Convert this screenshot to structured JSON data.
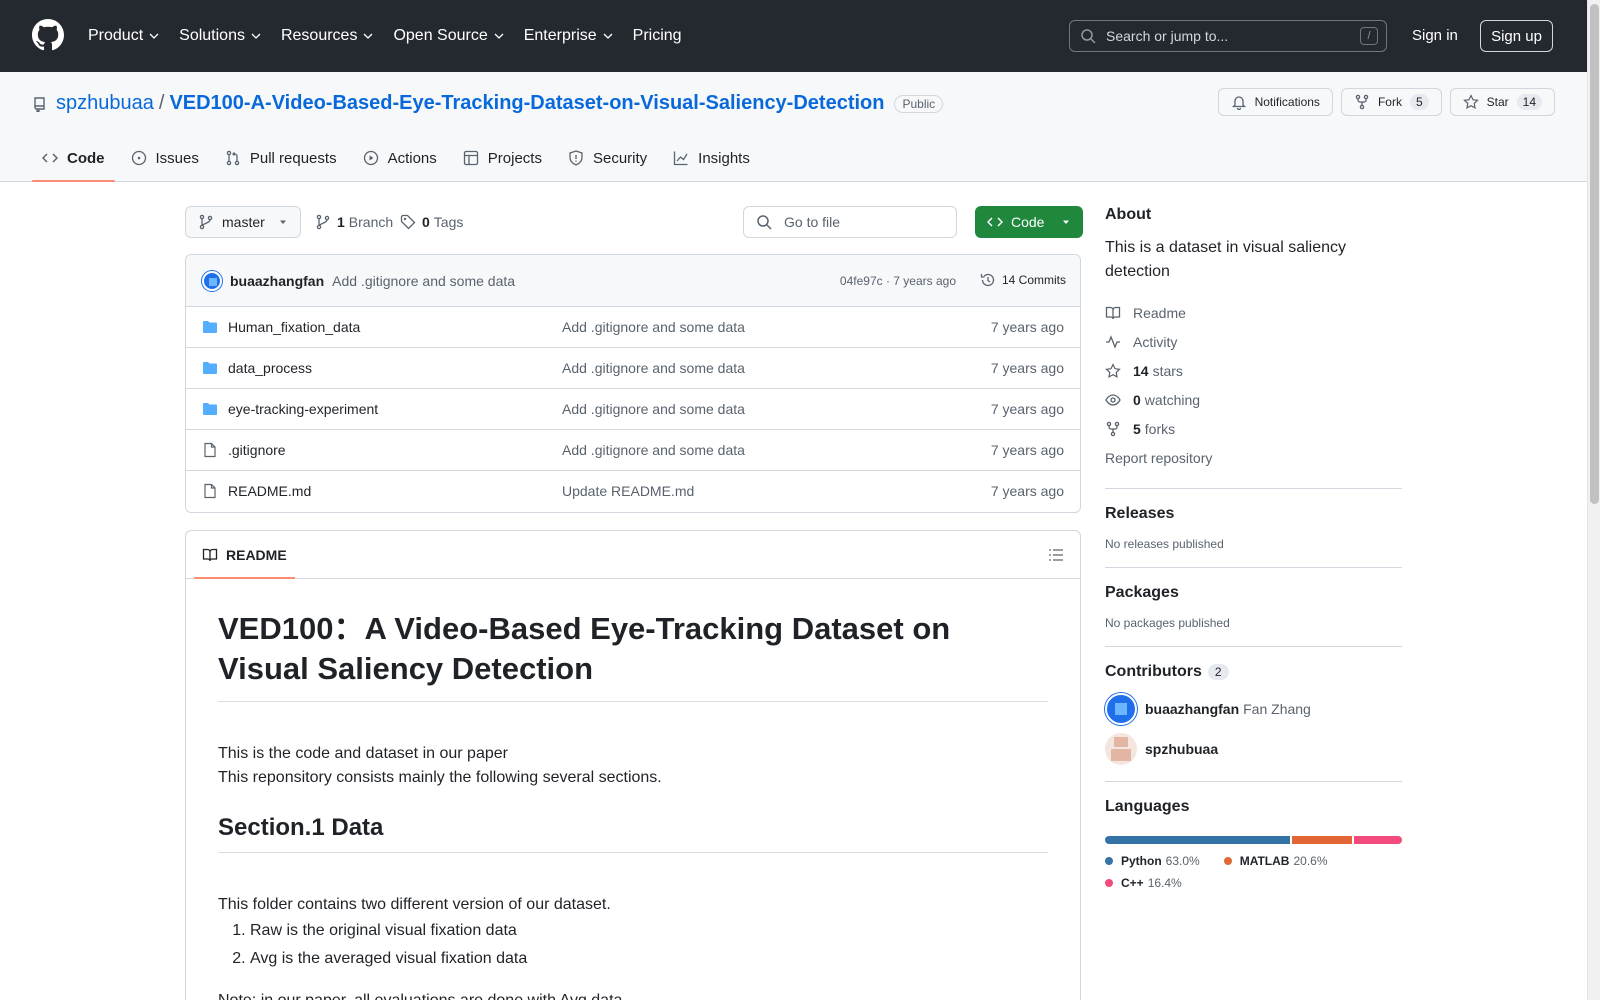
{
  "header": {
    "nav": [
      "Product",
      "Solutions",
      "Resources",
      "Open Source",
      "Enterprise",
      "Pricing"
    ],
    "search_placeholder": "Search or jump to...",
    "search_shortcut": "/",
    "sign_in": "Sign in",
    "sign_up": "Sign up"
  },
  "repo": {
    "owner": "spzhubuaa",
    "separator": "/",
    "name": "VED100-A-Video-Based-Eye-Tracking-Dataset-on-Visual-Saliency-Detection",
    "visibility": "Public",
    "notifications": "Notifications",
    "fork_label": "Fork",
    "fork_count": "5",
    "star_label": "Star",
    "star_count": "14",
    "tabs": [
      "Code",
      "Issues",
      "Pull requests",
      "Actions",
      "Projects",
      "Security",
      "Insights"
    ]
  },
  "code": {
    "branch": "master",
    "branch_count": "1",
    "branch_label": "Branch",
    "tag_count": "0",
    "tag_label": "Tags",
    "goto_placeholder": "Go to file",
    "code_button": "Code",
    "commit": {
      "author": "buaazhangfan",
      "message": "Add .gitignore and some data",
      "meta": "04fe97c · 7 years ago",
      "count": "14 Commits"
    },
    "files": [
      {
        "name": "Human_fixation_data",
        "type": "folder",
        "message": "Add .gitignore and some data",
        "age": "7 years ago"
      },
      {
        "name": "data_process",
        "type": "folder",
        "message": "Add .gitignore and some data",
        "age": "7 years ago"
      },
      {
        "name": "eye-tracking-experiment",
        "type": "folder",
        "message": "Add .gitignore and some data",
        "age": "7 years ago"
      },
      {
        "name": ".gitignore",
        "type": "file",
        "message": "Add .gitignore and some data",
        "age": "7 years ago"
      },
      {
        "name": "README.md",
        "type": "file",
        "message": "Update README.md",
        "age": "7 years ago"
      }
    ]
  },
  "readme": {
    "tab": "README",
    "title": "VED100：A Video-Based Eye-Tracking Dataset on Visual Saliency Detection",
    "intro_1": "This is the code and dataset in our paper",
    "intro_2": "This reponsitory consists mainly the following several sections.",
    "section_1": "Section.1 Data",
    "section_1_text": "This folder contains two different version of our dataset.",
    "list": [
      "Raw is the original visual fixation data",
      "Avg is the averaged visual fixation data"
    ],
    "note": "Note: in our paper, all evaluations are done with Avg data"
  },
  "sidebar": {
    "about_title": "About",
    "about_text": "This is a dataset in visual saliency detection",
    "readme": "Readme",
    "activity": "Activity",
    "stars_count": "14",
    "stars_label": "stars",
    "watching_count": "0",
    "watching_label": "watching",
    "forks_count": "5",
    "forks_label": "forks",
    "report": "Report repository",
    "releases_title": "Releases",
    "releases_text": "No releases published",
    "packages_title": "Packages",
    "packages_text": "No packages published",
    "contributors_title": "Contributors",
    "contributors_count": "2",
    "contributors": [
      {
        "login": "buaazhangfan",
        "name": "Fan Zhang"
      },
      {
        "login": "spzhubuaa",
        "name": ""
      }
    ],
    "languages_title": "Languages",
    "languages": [
      {
        "name": "Python",
        "percent": "63.0%",
        "value": 63.0,
        "color": "#3572A5"
      },
      {
        "name": "MATLAB",
        "percent": "20.6%",
        "value": 20.6,
        "color": "#e16737"
      },
      {
        "name": "C++",
        "percent": "16.4%",
        "value": 16.4,
        "color": "#f34b7d"
      }
    ]
  }
}
